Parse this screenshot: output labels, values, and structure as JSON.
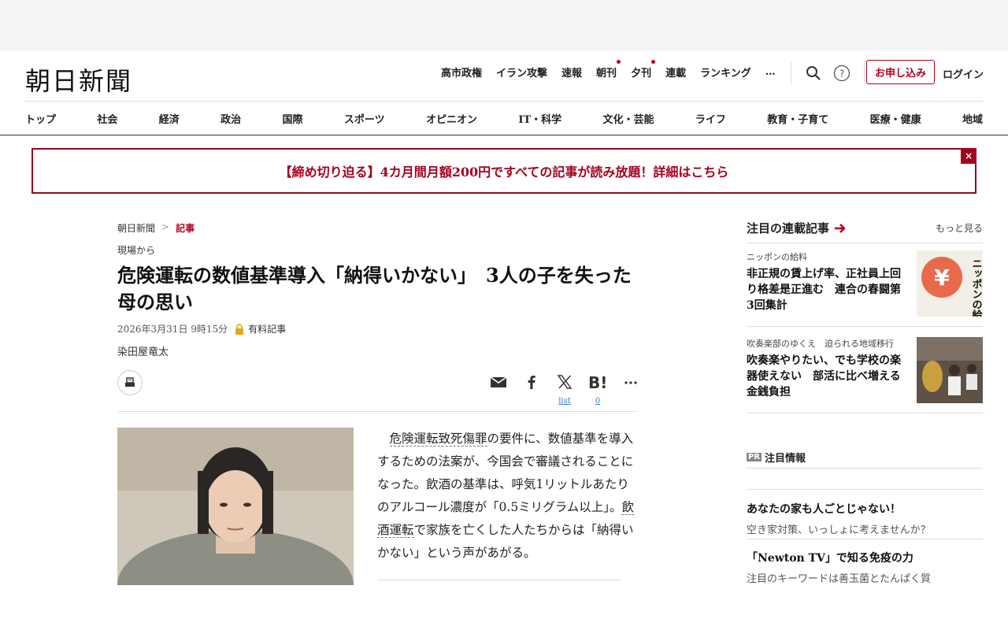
{
  "header": {
    "logo": "朝日新聞",
    "nav": [
      "高市政権",
      "イラン攻撃",
      "速報",
      "朝刊",
      "夕刊",
      "連載",
      "ランキング",
      "…"
    ],
    "subscribe": "お申し込み",
    "login": "ログイン"
  },
  "categories": [
    "トップ",
    "社会",
    "経済",
    "政治",
    "国際",
    "スポーツ",
    "オピニオン",
    "IT・科学",
    "文化・芸能",
    "ライフ",
    "教育・子育て",
    "医療・健康",
    "地域"
  ],
  "promo": {
    "text": "【締め切り迫る】4カ月間月額200円ですべての記事が読み放題！詳細はこちら",
    "close": "×"
  },
  "article": {
    "breadcrumb": {
      "home": "朝日新聞",
      "sep": ">",
      "current": "記事"
    },
    "section": "現場から",
    "title": "危険運転の数値基準導入「納得いかない」　3人の子を失った母の思い",
    "date": "2026年3月31日 9時15分",
    "paid": "有料記事",
    "author": "染田屋竜太",
    "share": {
      "list_label": "list",
      "hatena_count": "0"
    },
    "body_link1": "危険運転致死傷罪",
    "body_1": "の要件に、数値基準を導入するための法案が、今国会で審議されることになった。飲酒の基準は、呼気1リットルあたりのアルコール濃度が「0.5ミリグラム以上」。",
    "body_link2": "飲酒運転",
    "body_2": "で家族を亡くした人たちからは「納得いかない」という声があがる。"
  },
  "sidebar": {
    "heading": "注目の連載記事",
    "more": "もっと見る",
    "cards": [
      {
        "category": "ニッポンの給料",
        "headline": "非正規の賃上げ率、正社員上回り格差是正進む　連合の春闘第3回集計"
      },
      {
        "category": "吹奏楽部のゆくえ　迫られる地域移行",
        "headline": "吹奏楽やりたい、でも学校の楽器使えない　部活に比べ増える金銭負担"
      }
    ],
    "pr": {
      "badge": "PR",
      "heading": "注目情報",
      "items": [
        {
          "title": "あなたの家も人ごとじゃない！",
          "desc": "空き家対策、いっしょに考えませんか？"
        },
        {
          "title": "「Newton TV」で知る免疫の力",
          "desc": "注目のキーワードは善玉菌とたんぱく質"
        }
      ]
    },
    "thumb_text": "ニッポンの給料"
  },
  "colors": {
    "brand_red": "#b5001c",
    "promo_border": "#8a1020"
  }
}
